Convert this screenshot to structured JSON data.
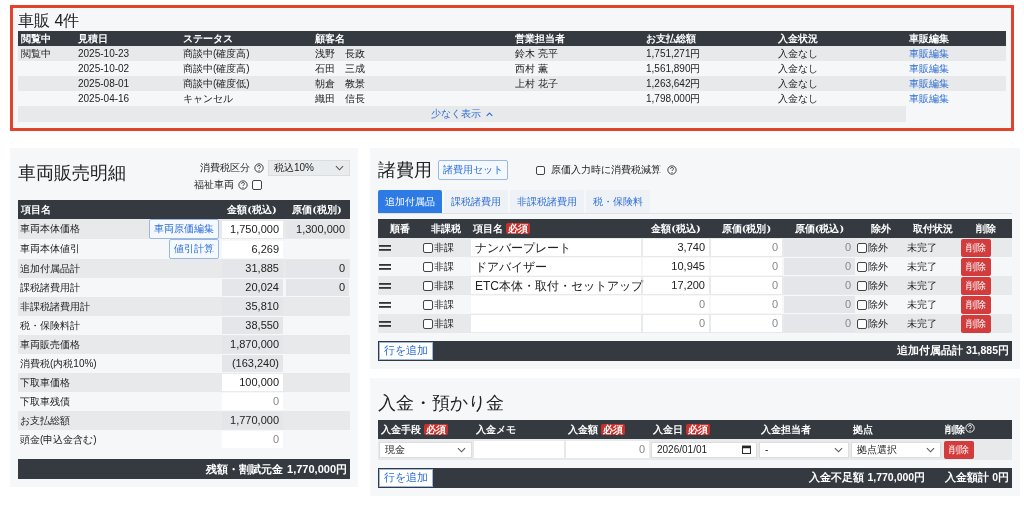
{
  "sales_list": {
    "title": "車販 4件",
    "columns": [
      "閲覧中",
      "見積日",
      "ステータス",
      "顧客名",
      "営業担当者",
      "お支払総額",
      "入金状況",
      "車販編集"
    ],
    "rows": [
      {
        "viewing": "閲覧中",
        "date": "2025-10-23",
        "status": "商談中(確度高)",
        "customer": "浅野　長政",
        "sales_rep": "鈴木 亮平",
        "total": "1,751,271円",
        "payment_status": "入金なし",
        "edit_link": "車販編集"
      },
      {
        "date": "2025-10-02",
        "status": "商談中(確度高)",
        "customer": "石田　三成",
        "sales_rep": "西村 薫",
        "total": "1,561,890円",
        "payment_status": "入金なし",
        "edit_link": "車販編集"
      },
      {
        "date": "2025-08-01",
        "status": "商談中(確度低)",
        "customer": "朝倉　教景",
        "sales_rep": "上村 花子",
        "total": "1,263,642円",
        "payment_status": "入金なし",
        "edit_link": "車販編集"
      },
      {
        "date": "2025-04-16",
        "status": "キャンセル",
        "customer": "織田　信長",
        "total": "1,798,000円",
        "payment_status": "入金なし",
        "edit_link": "車販編集"
      }
    ],
    "toggle": "少なく表示"
  },
  "vehicle_sales": {
    "title": "車両販売明細",
    "tax_category": {
      "label": "消費税区分",
      "value": "税込10%"
    },
    "welfare_vehicle": {
      "label": "福祉車両",
      "checked": false
    },
    "columns": [
      "項目名",
      "金額(税込)",
      "原価(税別)"
    ],
    "rows": [
      {
        "name": "車両本体価格",
        "button": "車両原価編集",
        "editable": true,
        "amount": "1,750,000",
        "cost": "1,300,000"
      },
      {
        "name": "車両本体値引",
        "button": "値引計算",
        "editable": true,
        "amount": "6,269"
      },
      {
        "name": "追加付属品計",
        "editable": false,
        "amount": "31,885",
        "cost": "0"
      },
      {
        "name": "課税諸費用計",
        "editable": false,
        "amount": "20,024",
        "cost": "0"
      },
      {
        "name": "非課税諸費用計",
        "editable": false,
        "amount": "35,810"
      },
      {
        "name": "税・保険料計",
        "editable": false,
        "amount": "38,550"
      },
      {
        "name": "車両販売価格",
        "editable": false,
        "amount": "1,870,000"
      },
      {
        "name": "消費税(内税10%)",
        "editable": false,
        "amount": "(163,240)"
      },
      {
        "name": "下取車価格",
        "editable": true,
        "amount": "100,000"
      },
      {
        "name": "下取車残債",
        "editable": true,
        "placeholder": "0"
      },
      {
        "name": "お支払総額",
        "editable": false,
        "amount": "1,770,000"
      },
      {
        "name": "頭金(申込金含む)",
        "editable": true,
        "placeholder": "0"
      }
    ],
    "footer": {
      "label": "残額・割賦元金",
      "value": "1,770,000円"
    }
  },
  "expenses": {
    "title": "諸費用",
    "set_button": "諸費用セット",
    "cost_tax_option": {
      "label": "原価入力時に消費税減算",
      "checked": false
    },
    "tabs": [
      {
        "label": "追加付属品",
        "selected": true
      },
      {
        "label": "課税諸費用",
        "selected": false
      },
      {
        "label": "非課税諸費用",
        "selected": false
      },
      {
        "label": "税・保険料",
        "selected": false
      }
    ],
    "columns": [
      {
        "label": "順番"
      },
      {
        "label": "非課税"
      },
      {
        "label": "項目名",
        "badge": "必須"
      },
      {
        "label": "金額(税込)"
      },
      {
        "label": "原価(税別)"
      },
      {
        "label": "原価(税込)"
      },
      {
        "label": "除外"
      },
      {
        "label": "取付状況"
      },
      {
        "label": "削除"
      }
    ],
    "rows": [
      {
        "non_taxable": false,
        "non_taxable_label": "非課",
        "name": "ナンバープレート",
        "amount": "3,740",
        "cost_placeholder": "0",
        "cost_incl_placeholder": "0",
        "excluded": false,
        "excluded_label": "除外",
        "install_status": "未完了",
        "delete": "削除"
      },
      {
        "non_taxable": false,
        "non_taxable_label": "非課",
        "name": "ドアバイザー",
        "amount": "10,945",
        "cost_placeholder": "0",
        "cost_incl_placeholder": "0",
        "excluded": false,
        "excluded_label": "除外",
        "install_status": "未完了",
        "delete": "削除"
      },
      {
        "non_taxable": false,
        "non_taxable_label": "非課",
        "name": "ETC本体・取付・セットアップ",
        "amount": "17,200",
        "cost_placeholder": "0",
        "cost_incl_placeholder": "0",
        "excluded": false,
        "excluded_label": "除外",
        "install_status": "未完了",
        "delete": "削除"
      },
      {
        "non_taxable": false,
        "non_taxable_label": "非課",
        "amount_placeholder": "0",
        "cost_placeholder": "0",
        "cost_incl_placeholder": "0",
        "excluded": false,
        "excluded_label": "除外",
        "install_status": "未完了",
        "delete": "削除"
      },
      {
        "non_taxable": false,
        "non_taxable_label": "非課",
        "amount_placeholder": "0",
        "cost_placeholder": "0",
        "cost_incl_placeholder": "0",
        "excluded": false,
        "excluded_label": "除外",
        "install_status": "未完了",
        "delete": "削除"
      }
    ],
    "add_row": "行を追加",
    "total": {
      "label": "追加付属品計",
      "value": "31,885円"
    }
  },
  "payments": {
    "title": "入金・預かり金",
    "columns": [
      {
        "label": "入金手段",
        "badge": "必須"
      },
      {
        "label": "入金メモ"
      },
      {
        "label": "入金額",
        "badge": "必須"
      },
      {
        "label": "入金日",
        "badge": "必須"
      },
      {
        "label": "入金担当者"
      },
      {
        "label": "拠点"
      },
      {
        "label": "削除",
        "help": true
      }
    ],
    "rows": [
      {
        "method": "現金",
        "amount_placeholder": "0",
        "date": "2026/01/01",
        "staff": "-",
        "branch": "拠点選択",
        "delete": "削除"
      }
    ],
    "add_row": "行を追加",
    "shortfall": {
      "label": "入金不足額",
      "value": "1,770,000円"
    },
    "total": {
      "label": "入金額計",
      "value": "0円"
    }
  }
}
